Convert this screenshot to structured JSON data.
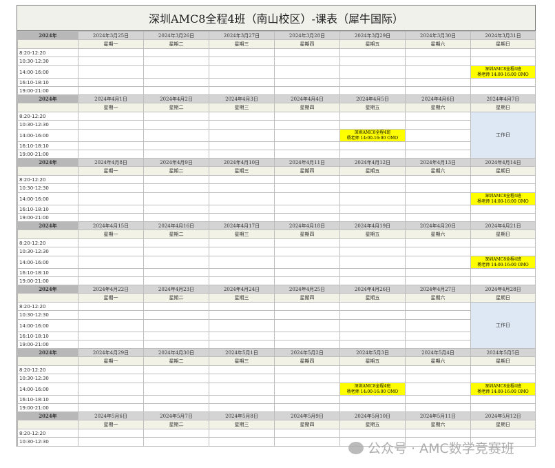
{
  "title": "深圳AMC8全程4班（南山校区）-课表（犀牛国际）",
  "year_label": "2024年",
  "weekdays": [
    "星期一",
    "星期二",
    "星期三",
    "星期四",
    "星期五",
    "星期六",
    "星期日"
  ],
  "event_line1": "深圳AMC8全程4班",
  "event_line2": "杨老师 14:00-16:00 OMO",
  "workday_label": "工作日",
  "weeks": [
    {
      "dates": [
        "2024年3月25日",
        "2024年3月26日",
        "2024年3月27日",
        "2024年3月28日",
        "2024年3月29日",
        "2024年3月30日",
        "2024年3月31日"
      ],
      "slots": [
        "8:20-12:20",
        "10:30-12:30",
        "14:00-16:00",
        "16:10-18:10",
        "19:00-21:00"
      ],
      "events": [
        [
          2,
          6
        ]
      ],
      "workday": null
    },
    {
      "dates": [
        "2024年4月1日",
        "2024年4月2日",
        "2024年4月3日",
        "2024年4月4日",
        "2024年4月5日",
        "2024年4月6日",
        "2024年4月7日"
      ],
      "slots": [
        "8:20-12:20",
        "10:30-12:30",
        "14:00-16:00",
        "16:10-18:10",
        "19:00-21:00"
      ],
      "events": [
        [
          2,
          4
        ]
      ],
      "workday": 6
    },
    {
      "dates": [
        "2024年4月8日",
        "2024年4月9日",
        "2024年4月10日",
        "2024年4月11日",
        "2024年4月12日",
        "2024年4月13日",
        "2024年4月14日"
      ],
      "slots": [
        "8:20-12:20",
        "10:30-12:30",
        "14:00-16:00",
        "16:10-18:10",
        "19:00-21:00"
      ],
      "events": [
        [
          2,
          6
        ]
      ],
      "workday": null
    },
    {
      "dates": [
        "2024年4月15日",
        "2024年4月16日",
        "2024年4月17日",
        "2024年4月18日",
        "2024年4月19日",
        "2024年4月20日",
        "2024年4月21日"
      ],
      "slots": [
        "8:20-12:20",
        "10:30-12:30",
        "14:00-16:00",
        "16:10-18:10",
        "19:00-21:00"
      ],
      "events": [
        [
          2,
          6
        ]
      ],
      "workday": null
    },
    {
      "dates": [
        "2024年4月22日",
        "2024年4月23日",
        "2024年4月24日",
        "2024年4月25日",
        "2024年4月26日",
        "2024年4月27日",
        "2024年4月28日"
      ],
      "slots": [
        "8:20-12:20",
        "10:30-12:30",
        "14:00-16:00",
        "16:10-18:10",
        "19:00-21:00"
      ],
      "events": [],
      "workday": 6
    },
    {
      "dates": [
        "2024年4月29日",
        "2024年4月30日",
        "2024年5月1日",
        "2024年5月2日",
        "2024年5月3日",
        "2024年5月4日",
        "2024年5月5日"
      ],
      "slots": [
        "8:20-12:20",
        "10:30-12:30",
        "14:00-16:00",
        "16:10-18:10",
        "19:00-21:00"
      ],
      "events": [
        [
          2,
          4
        ],
        [
          2,
          6
        ]
      ],
      "workday": null
    },
    {
      "dates": [
        "2024年5月6日",
        "2024年5月7日",
        "2024年5月8日",
        "2024年5月9日",
        "2024年5月10日",
        "2024年5月11日",
        "2024年5月12日"
      ],
      "slots": [
        "8:20-12:20",
        "10:30-12:30"
      ],
      "events": [],
      "workday": null
    }
  ],
  "watermark": "公众号 · AMC数学竞赛班"
}
